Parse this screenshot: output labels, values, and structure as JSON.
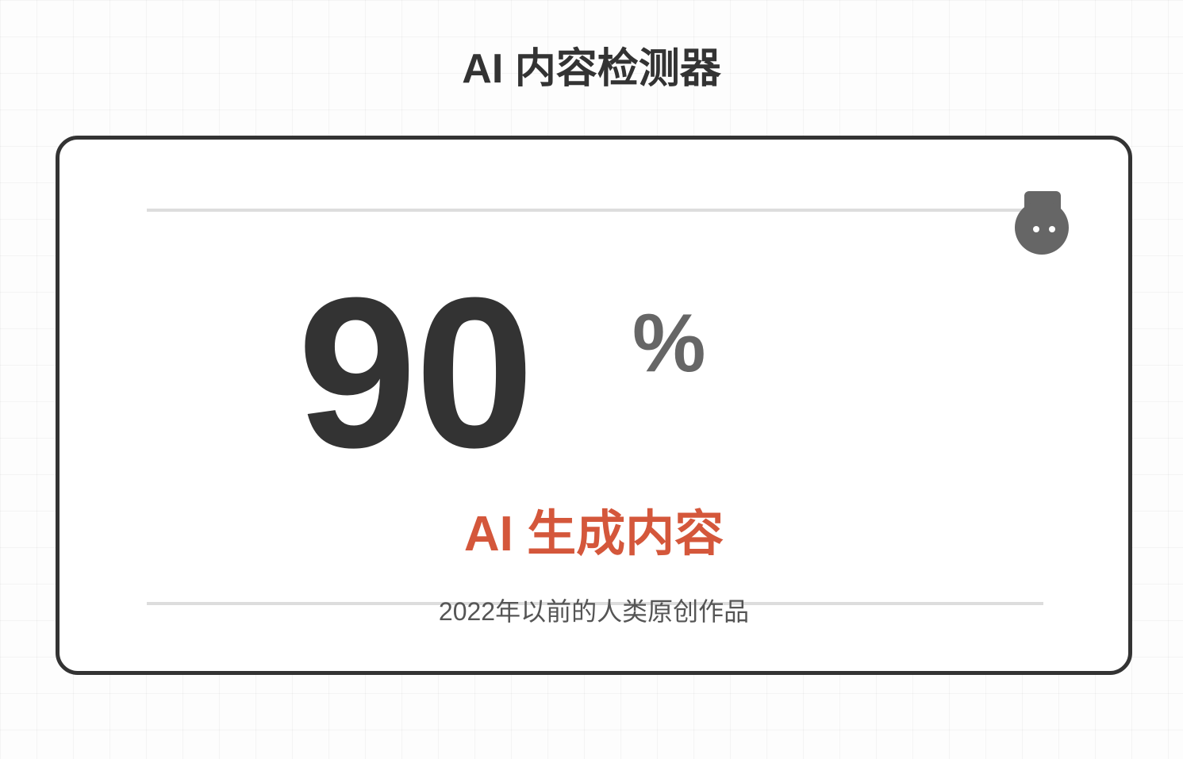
{
  "page": {
    "title": "AI 内容检测器"
  },
  "result": {
    "score": "90",
    "unit": "%",
    "score_fraction": 0.9,
    "verdict": "AI 生成内容",
    "verdict_color": "#d4573b",
    "caption": "2022年以前的人类原创作品"
  },
  "meter": {
    "marker_icon": "robot-head-icon",
    "marker_color": "#666666",
    "track_color": "#dddddd"
  },
  "theme": {
    "text_color": "#333333",
    "border_color": "#333333",
    "background": "#fdfdfd"
  }
}
